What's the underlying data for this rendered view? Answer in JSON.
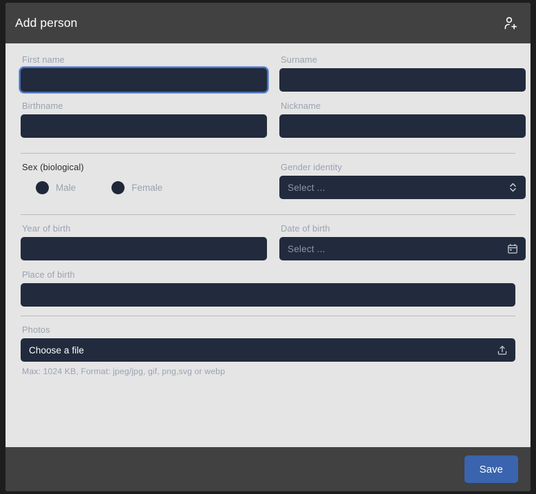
{
  "header": {
    "title": "Add person",
    "icon": "person-add-icon"
  },
  "form": {
    "first_name": {
      "label": "First name",
      "value": "",
      "placeholder": ""
    },
    "surname": {
      "label": "Surname",
      "value": "",
      "placeholder": ""
    },
    "birthname": {
      "label": "Birthname",
      "value": "",
      "placeholder": ""
    },
    "nickname": {
      "label": "Nickname",
      "value": "",
      "placeholder": ""
    },
    "sex": {
      "label": "Sex (biological)",
      "options": [
        {
          "label": "Male",
          "selected": false
        },
        {
          "label": "Female",
          "selected": false
        }
      ]
    },
    "gender_identity": {
      "label": "Gender identity",
      "placeholder": "Select ...",
      "icon": "chevron-up-down-icon"
    },
    "year_of_birth": {
      "label": "Year of birth",
      "value": "",
      "placeholder": ""
    },
    "date_of_birth": {
      "label": "Date of birth",
      "placeholder": "Select ...",
      "icon": "calendar-icon"
    },
    "place_of_birth": {
      "label": "Place of birth",
      "value": "",
      "placeholder": ""
    },
    "photos": {
      "label": "Photos",
      "button_text": "Choose a file",
      "icon": "upload-icon",
      "hint": "Max: 1024 KB, Format: jpeg/jpg, gif, png,svg or webp"
    }
  },
  "footer": {
    "save_label": "Save"
  },
  "colors": {
    "accent": "#3a64ad",
    "field_bg": "#222b3d",
    "panel_bg": "#e5e5e5",
    "chrome_bg": "#414141",
    "focus_ring": "#8aa9df"
  }
}
